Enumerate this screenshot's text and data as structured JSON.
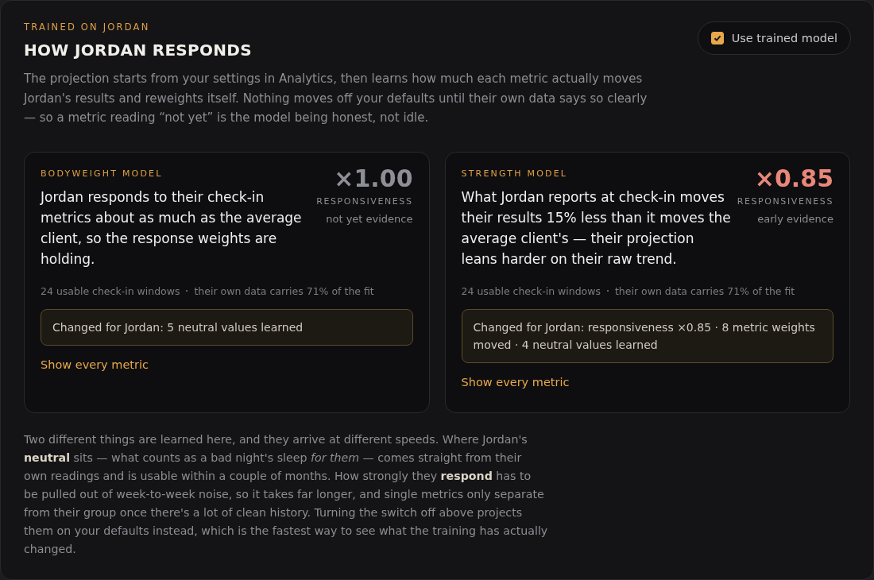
{
  "header": {
    "eyebrow": "TRAINED ON JORDAN",
    "title": "HOW JORDAN RESPONDS",
    "intro": "The projection starts from your settings in Analytics, then learns how much each metric actually moves Jordan's results and reweights itself. Nothing moves off your defaults until their own data says so clearly — so a metric reading “not yet” is the model being honest, not idle."
  },
  "toggle": {
    "label": "Use trained model",
    "checked": true
  },
  "models": [
    {
      "eyebrow": "BODYWEIGHT MODEL",
      "summary": "Jordan responds to their check-in metrics about as much as the average client, so the response weights are holding.",
      "multiplier": "×1.00",
      "color": "#8e8e96",
      "multiplier_label": "RESPONSIVENESS",
      "evidence": "not yet evidence",
      "stats": [
        "24 usable check-in windows",
        "their own data carries 71% of the fit"
      ],
      "changes": "Changed for Jordan: 5 neutral values learned",
      "link": "Show every metric"
    },
    {
      "eyebrow": "STRENGTH MODEL",
      "summary": "What Jordan reports at check-in moves their results 15% less than it moves the average client's — their projection leans harder on their raw trend.",
      "multiplier": "×0.85",
      "color": "#e8877a",
      "multiplier_label": "RESPONSIVENESS",
      "evidence": "early evidence",
      "stats": [
        "24 usable check-in windows",
        "their own data carries 71% of the fit"
      ],
      "changes": "Changed for Jordan: responsiveness ×0.85 · 8 metric weights moved · 4 neutral values learned",
      "link": "Show every metric"
    }
  ],
  "footnote": "Two different things are learned here, and they arrive at different speeds. Where Jordan's **neutral** sits — what counts as a bad night's sleep *for them* — comes straight from their own readings and is usable within a couple of months. How strongly they **respond** has to be pulled out of week-to-week noise, so it takes far longer, and single metrics only separate from their group once there's a lot of clean history. Turning the switch off above projects them on your defaults instead, which is the fastest way to see what the training has actually changed."
}
